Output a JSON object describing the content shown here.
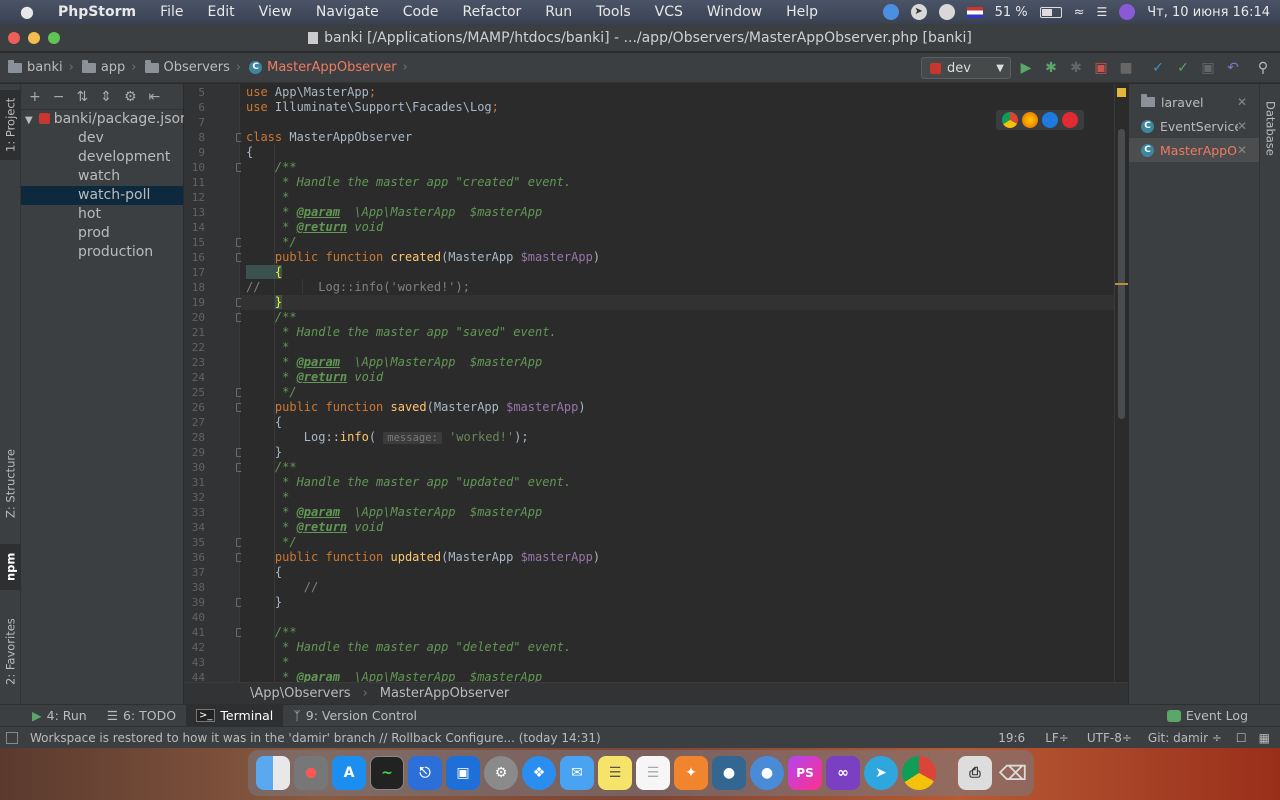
{
  "menubar": {
    "apple": "",
    "app": "PhpStorm",
    "items": [
      "File",
      "Edit",
      "View",
      "Navigate",
      "Code",
      "Refactor",
      "Run",
      "Tools",
      "VCS",
      "Window",
      "Help"
    ],
    "flag": "EN",
    "battery": "51 %",
    "datetime": "Чт, 10 июня  16:14"
  },
  "window": {
    "title": "banki [/Applications/MAMP/htdocs/banki] - .../app/Observers/MasterAppObserver.php [banki]"
  },
  "nav": {
    "crumbs": [
      "banki",
      "app",
      "Observers",
      "MasterAppObserver"
    ],
    "run_config": "dev"
  },
  "left_stripe": {
    "project": "1: Project",
    "structure": "Z: Structure",
    "npm": "npm",
    "favorites": "2: Favorites"
  },
  "project_tree": {
    "root": "banki/package.json",
    "items": [
      "dev",
      "development",
      "watch",
      "watch-poll",
      "hot",
      "prod",
      "production"
    ],
    "selected": "watch-poll"
  },
  "editor": {
    "line_numbers": [
      "5",
      "6",
      "7",
      "8",
      "9",
      "10",
      "11",
      "12",
      "13",
      "14",
      "15",
      "16",
      "17",
      "18",
      "19",
      "20",
      "21",
      "22",
      "23",
      "24",
      "25",
      "26",
      "27",
      "28",
      "29",
      "30",
      "31",
      "32",
      "33",
      "34",
      "35",
      "36",
      "37",
      "38",
      "39",
      "40",
      "41",
      "42",
      "43",
      "44"
    ],
    "lines": [
      [
        [
          "kw",
          "use "
        ],
        [
          "",
          "App\\MasterApp"
        ],
        [
          "kw",
          ";"
        ]
      ],
      [
        [
          "kw",
          "use "
        ],
        [
          "",
          "Illuminate\\Support\\Facades\\Log"
        ],
        [
          "kw",
          ";"
        ]
      ],
      [],
      [
        [
          "kw",
          "class "
        ],
        [
          "",
          "MasterAppObserver"
        ]
      ],
      [
        [
          "",
          "{"
        ]
      ],
      [
        [
          "cm",
          "    /**"
        ]
      ],
      [
        [
          "cm",
          "     * Handle the master app \"created\" event."
        ]
      ],
      [
        [
          "cm",
          "     *"
        ]
      ],
      [
        [
          "cm",
          "     * "
        ],
        [
          "tag",
          "@param"
        ],
        [
          "cm",
          "  \\App\\MasterApp  $masterApp"
        ]
      ],
      [
        [
          "cm",
          "     * "
        ],
        [
          "tag",
          "@return"
        ],
        [
          "cm",
          " void"
        ]
      ],
      [
        [
          "cm",
          "     */"
        ]
      ],
      [
        [
          "kw",
          "    public function "
        ],
        [
          "fn",
          "created"
        ],
        [
          "",
          "(MasterApp "
        ],
        [
          "var",
          "$masterApp"
        ],
        [
          "",
          ")"
        ]
      ],
      [
        [
          "brace",
          "    {"
        ]
      ],
      [
        [
          "lc",
          "//        Log::info('worked!');"
        ]
      ],
      [
        [
          "",
          "    "
        ],
        [
          "brace",
          "}"
        ]
      ],
      [
        [
          "cm",
          "    /**"
        ]
      ],
      [
        [
          "cm",
          "     * Handle the master app \"saved\" event."
        ]
      ],
      [
        [
          "cm",
          "     *"
        ]
      ],
      [
        [
          "cm",
          "     * "
        ],
        [
          "tag",
          "@param"
        ],
        [
          "cm",
          "  \\App\\MasterApp  $masterApp"
        ]
      ],
      [
        [
          "cm",
          "     * "
        ],
        [
          "tag",
          "@return"
        ],
        [
          "cm",
          " void"
        ]
      ],
      [
        [
          "cm",
          "     */"
        ]
      ],
      [
        [
          "kw",
          "    public function "
        ],
        [
          "fn",
          "saved"
        ],
        [
          "",
          "(MasterApp "
        ],
        [
          "var",
          "$masterApp"
        ],
        [
          "",
          ")"
        ]
      ],
      [
        [
          "",
          "    {"
        ]
      ],
      [
        [
          "",
          "        Log::"
        ],
        [
          "fn",
          "info"
        ],
        [
          "",
          "( "
        ],
        [
          "hint",
          "message:"
        ],
        [
          "str",
          " 'worked!'"
        ],
        [
          "",
          ");"
        ]
      ],
      [
        [
          "",
          "    }"
        ]
      ],
      [
        [
          "cm",
          "    /**"
        ]
      ],
      [
        [
          "cm",
          "     * Handle the master app \"updated\" event."
        ]
      ],
      [
        [
          "cm",
          "     *"
        ]
      ],
      [
        [
          "cm",
          "     * "
        ],
        [
          "tag",
          "@param"
        ],
        [
          "cm",
          "  \\App\\MasterApp  $masterApp"
        ]
      ],
      [
        [
          "cm",
          "     * "
        ],
        [
          "tag",
          "@return"
        ],
        [
          "cm",
          " void"
        ]
      ],
      [
        [
          "cm",
          "     */"
        ]
      ],
      [
        [
          "kw",
          "    public function "
        ],
        [
          "fn",
          "updated"
        ],
        [
          "",
          "(MasterApp "
        ],
        [
          "var",
          "$masterApp"
        ],
        [
          "",
          ")"
        ]
      ],
      [
        [
          "",
          "    {"
        ]
      ],
      [
        [
          "lc",
          "        //"
        ]
      ],
      [
        [
          "",
          "    }"
        ]
      ],
      [],
      [
        [
          "cm",
          "    /**"
        ]
      ],
      [
        [
          "cm",
          "     * Handle the master app \"deleted\" event."
        ]
      ],
      [
        [
          "cm",
          "     *"
        ]
      ],
      [
        [
          "cm",
          "     * "
        ],
        [
          "tag",
          "@param"
        ],
        [
          "cm",
          "  \\App\\MasterApp  $masterApp"
        ]
      ]
    ]
  },
  "recent_files": [
    {
      "name": "laravel",
      "icon": "folder"
    },
    {
      "name": "EventServiceProvider.php",
      "icon": "class"
    },
    {
      "name": "MasterAppObserver.php",
      "icon": "class",
      "active": true
    }
  ],
  "right_stripe": {
    "database": "Database"
  },
  "code_breadcrumb": [
    "\\App\\Observers",
    "MasterAppObserver"
  ],
  "tool_tabs": [
    {
      "label": "4: Run",
      "icon": "run-icon"
    },
    {
      "label": "6: TODO",
      "icon": "todo-icon"
    },
    {
      "label": "Terminal",
      "icon": "terminal-icon",
      "active": true
    },
    {
      "label": "9: Version Control",
      "icon": "vcs-icon"
    }
  ],
  "event_log": "Event Log",
  "status": {
    "message": "Workspace is restored to how it was in the 'damir' branch // Rollback Configure... (today 14:31)",
    "position": "19:6",
    "line_sep": "LF÷",
    "encoding": "UTF-8÷",
    "git": "Git: damir ÷"
  },
  "dock": {
    "ps_label": "PS"
  }
}
